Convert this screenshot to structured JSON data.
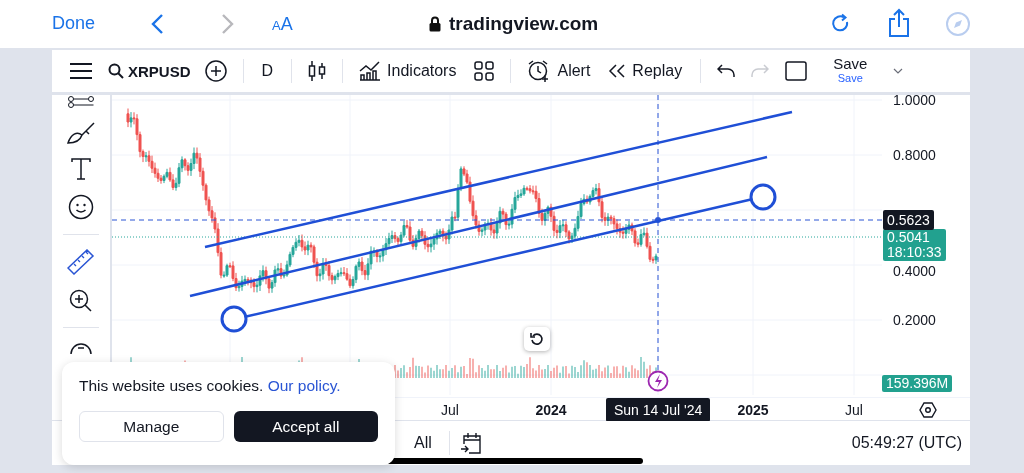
{
  "browser": {
    "done": "Done",
    "text_size": "AA",
    "url": "tradingview.com"
  },
  "toolbar": {
    "symbol": "XRPUSD",
    "interval": "D",
    "indicators": "Indicators",
    "alert": "Alert",
    "replay": "Replay",
    "save": "Save",
    "save_sub": "Save"
  },
  "chart": {
    "price_labels": [
      "1.0000",
      "0.8000",
      "0.4000",
      "0.2000"
    ],
    "crosshair_price": "0.5623",
    "last_price": "0.5041",
    "countdown": "18:10:33",
    "volume": "159.396M",
    "time_labels": [
      {
        "text": "Jul",
        "bold": false
      },
      {
        "text": "2024",
        "bold": true
      },
      {
        "text": "2025",
        "bold": true
      },
      {
        "text": "Jul",
        "bold": false
      }
    ],
    "crosshair_date": "Sun 14 Jul '24"
  },
  "bottom_bar": {
    "range": "All",
    "clock": "05:49:27 (UTC)"
  },
  "cookie_banner": {
    "text": "This website uses cookies.",
    "link": "Our policy.",
    "manage": "Manage",
    "accept": "Accept all"
  }
}
